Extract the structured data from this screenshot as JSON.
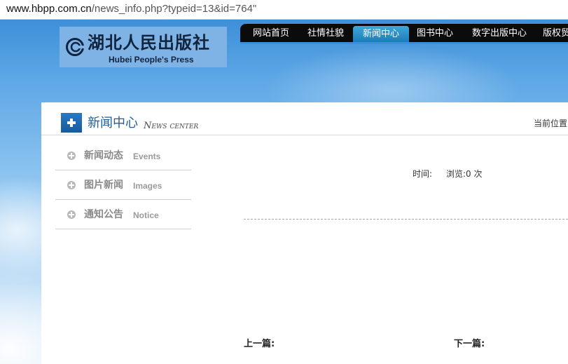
{
  "browser": {
    "url_host": "www.hbpp.com.cn",
    "url_path": "/news_info.php?typeid=13&id=764\""
  },
  "logo": {
    "name_cn": "湖北人民出版社",
    "name_en": "Hubei People's Press"
  },
  "nav": {
    "items": [
      {
        "label": "网站首页"
      },
      {
        "label": "社情社貌"
      },
      {
        "label": "新闻中心",
        "active": true
      },
      {
        "label": "图书中心"
      },
      {
        "label": "数字出版中心"
      },
      {
        "label": "版权贸"
      }
    ]
  },
  "section": {
    "title_cn": "新闻中心",
    "title_en": "News center",
    "breadcrumb": "当前位置"
  },
  "sidebar": {
    "items": [
      {
        "cn": "新闻动态",
        "en": "Events"
      },
      {
        "cn": "图片新闻",
        "en": "Images"
      },
      {
        "cn": "通知公告",
        "en": "Notice"
      }
    ]
  },
  "article": {
    "time_label": "时间:",
    "views_label": "浏览:0 次",
    "prev_label": "上一篇:",
    "next_label": "下一篇:"
  },
  "colors": {
    "nav_bg": "#0b0b0b",
    "nav_active": "#1a7fb8",
    "section_title": "#1f5e9e",
    "header_icon": "#2a79c4"
  }
}
